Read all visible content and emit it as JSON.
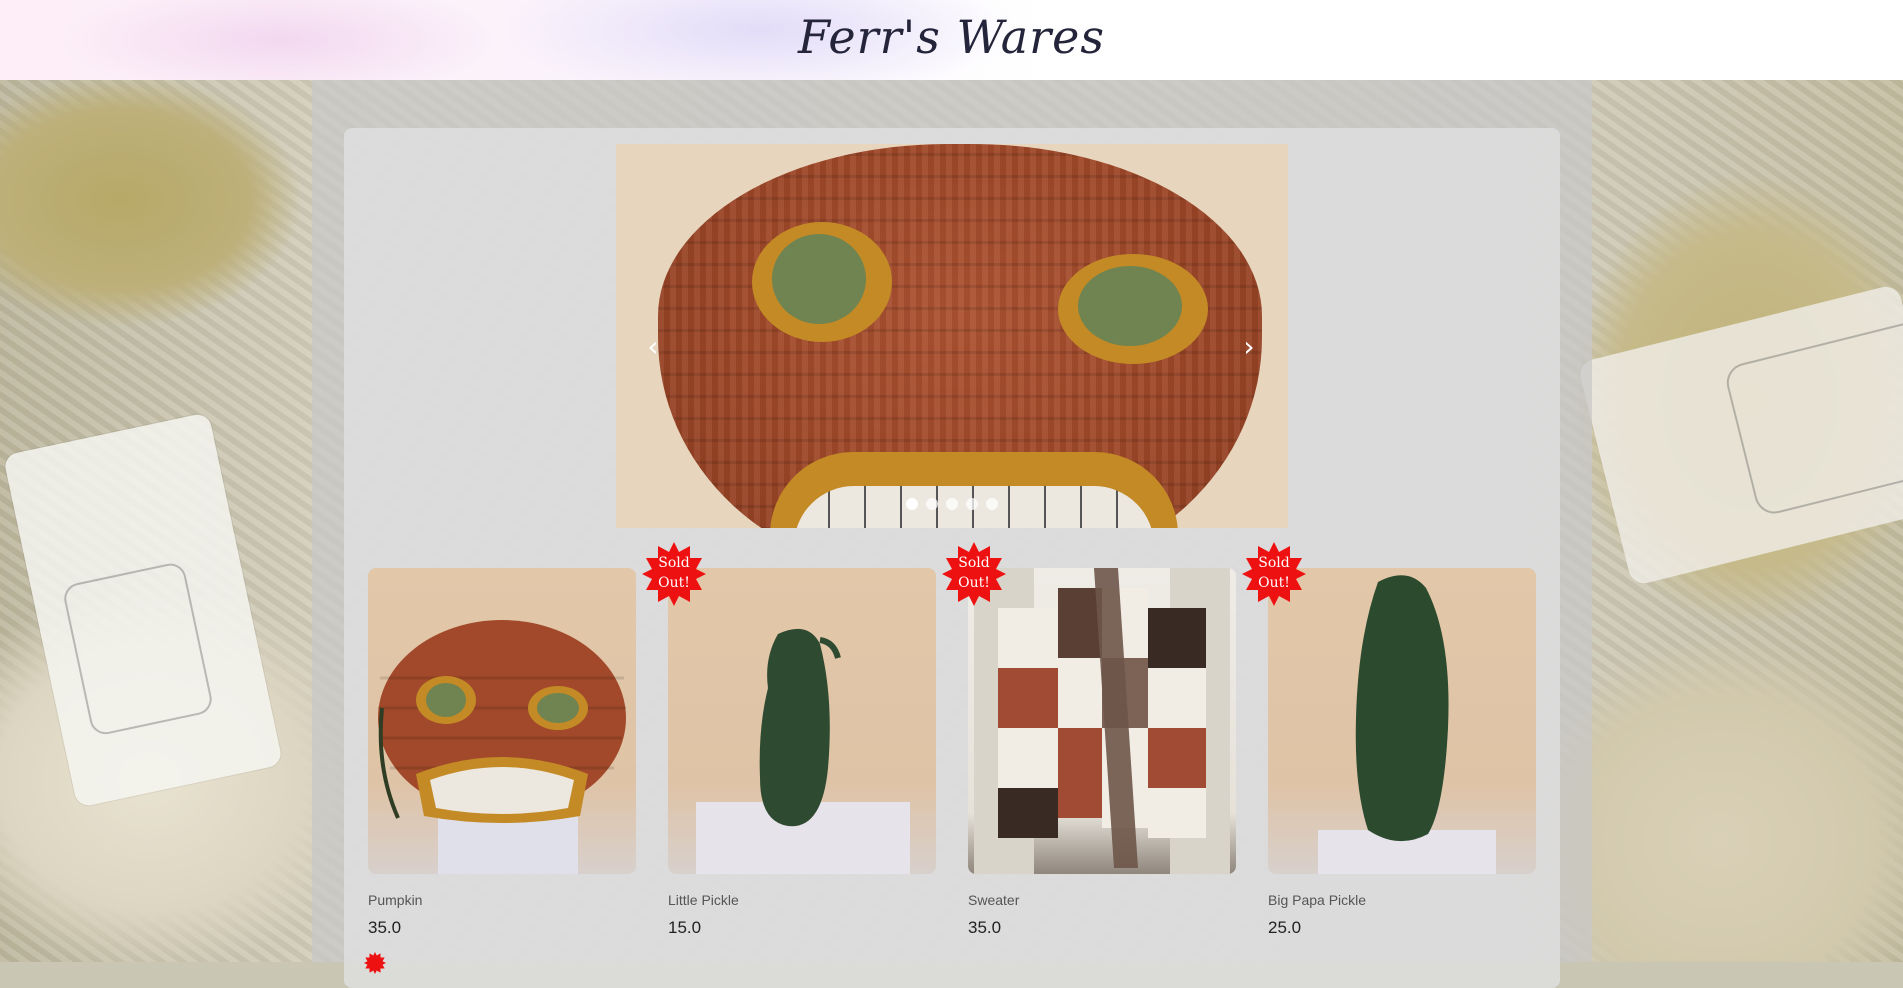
{
  "site": {
    "title": "Ferr's Wares"
  },
  "carousel": {
    "prev_icon": "chevron-left-icon",
    "next_icon": "chevron-right-icon",
    "prev_glyph": "‹",
    "next_glyph": "›",
    "slide_count": 5,
    "active_index": 0
  },
  "badge": {
    "line1": "Sold",
    "line2": "Out!",
    "color": "#ee1111"
  },
  "products": [
    {
      "name": "Pumpkin",
      "price": "35.0",
      "sold_out": false
    },
    {
      "name": "Little Pickle",
      "price": "15.0",
      "sold_out": true
    },
    {
      "name": "Sweater",
      "price": "35.0",
      "sold_out": true
    },
    {
      "name": "Big Papa Pickle",
      "price": "25.0",
      "sold_out": true
    }
  ]
}
